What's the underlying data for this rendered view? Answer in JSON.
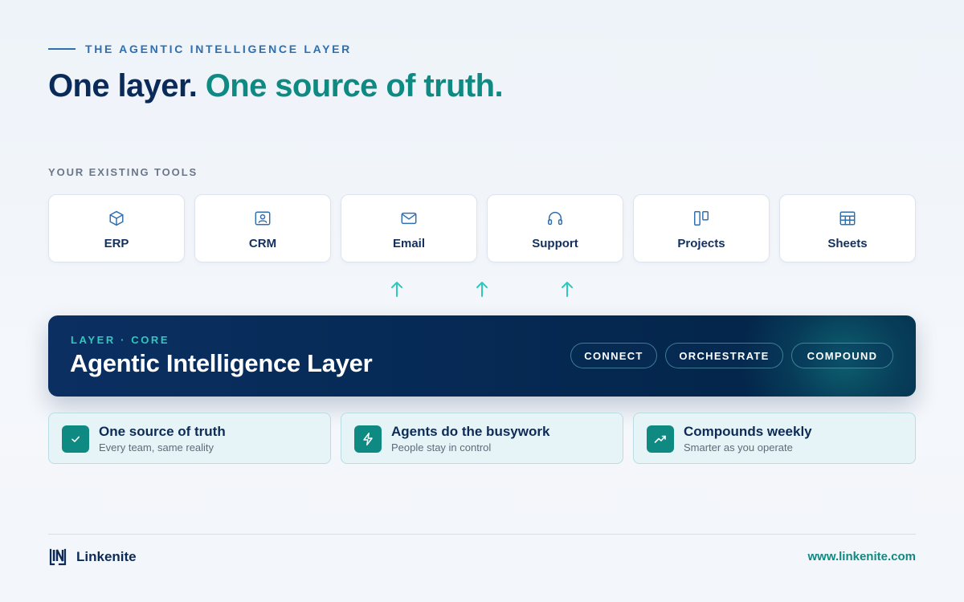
{
  "eyebrow": "THE AGENTIC INTELLIGENCE LAYER",
  "headline": {
    "part1": "One layer.",
    "part2": "One source of truth."
  },
  "tools_label": "YOUR EXISTING TOOLS",
  "tools": [
    {
      "label": "ERP",
      "icon": "box-icon"
    },
    {
      "label": "CRM",
      "icon": "contact-card-icon"
    },
    {
      "label": "Email",
      "icon": "envelope-icon"
    },
    {
      "label": "Support",
      "icon": "headphones-icon"
    },
    {
      "label": "Projects",
      "icon": "kanban-icon"
    },
    {
      "label": "Sheets",
      "icon": "table-icon"
    }
  ],
  "core": {
    "eyebrow": "LAYER · CORE",
    "title": "Agentic Intelligence Layer",
    "pills": [
      "CONNECT",
      "ORCHESTRATE",
      "COMPOUND"
    ]
  },
  "benefits": [
    {
      "title": "One source of truth",
      "subtitle": "Every team, same reality",
      "icon": "check-icon"
    },
    {
      "title": "Agents do the busywork",
      "subtitle": "People stay in control",
      "icon": "lightning-icon"
    },
    {
      "title": "Compounds weekly",
      "subtitle": "Smarter as you operate",
      "icon": "trend-up-icon"
    }
  ],
  "footer": {
    "brand": "Linkenite",
    "website": "www.linkenite.com"
  },
  "colors": {
    "navy": "#0a2a5a",
    "teal": "#0e8a82",
    "accent_blue": "#2f6fb0",
    "arrow_teal": "#2ec9bd"
  }
}
